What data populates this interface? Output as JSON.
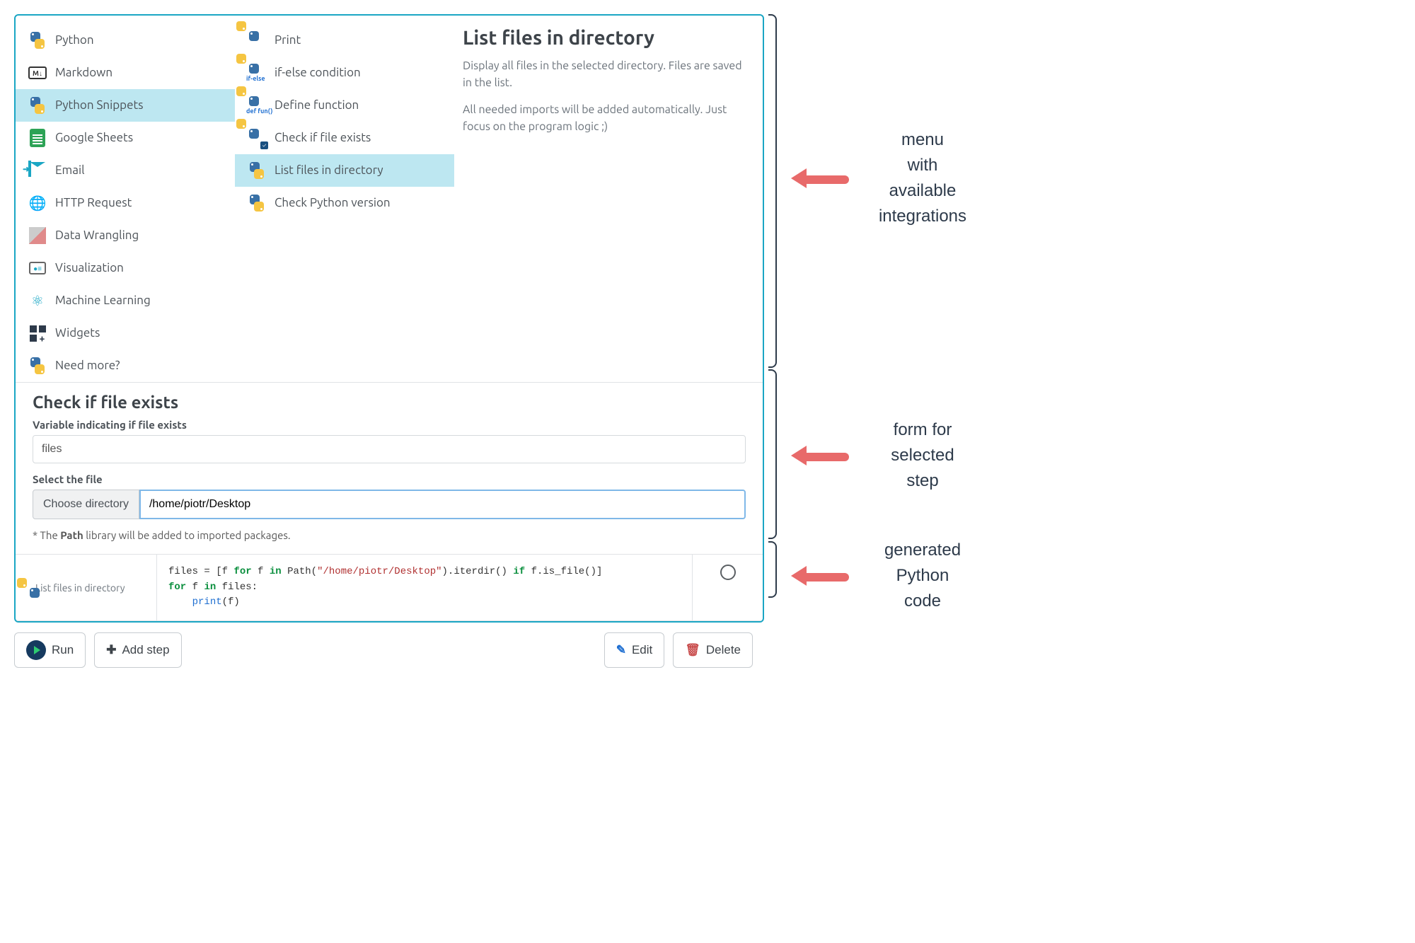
{
  "integrations": [
    {
      "label": "Python",
      "icon": "python-icon"
    },
    {
      "label": "Markdown",
      "icon": "markdown-icon"
    },
    {
      "label": "Python Snippets",
      "icon": "python-icon",
      "selected": true
    },
    {
      "label": "Google Sheets",
      "icon": "sheets-icon"
    },
    {
      "label": "Email",
      "icon": "email-icon"
    },
    {
      "label": "HTTP Request",
      "icon": "http-icon"
    },
    {
      "label": "Data Wrangling",
      "icon": "wrangling-icon"
    },
    {
      "label": "Visualization",
      "icon": "viz-icon"
    },
    {
      "label": "Machine Learning",
      "icon": "ml-icon"
    },
    {
      "label": "Widgets",
      "icon": "widgets-icon"
    },
    {
      "label": "Need more?",
      "icon": "python-icon"
    }
  ],
  "snippets": [
    {
      "label": "Print",
      "sub": ""
    },
    {
      "label": "if-else condition",
      "sub": "if-else"
    },
    {
      "label": "Define function",
      "sub": "def fun()"
    },
    {
      "label": "Check if file exists",
      "sub": "",
      "badge": "check"
    },
    {
      "label": "List files in directory",
      "sub": "",
      "selected": true
    },
    {
      "label": "Check Python version",
      "sub": ""
    }
  ],
  "detail": {
    "title": "List files in directory",
    "desc": "Display all files in the selected directory. Files are saved in the list.",
    "note": "All needed imports will be added automatically. Just focus on the program logic ;)"
  },
  "form": {
    "title": "Check if file exists",
    "var_label": "Variable indicating if file exists",
    "var_value": "files",
    "select_label": "Select the file",
    "choose_button": "Choose directory",
    "path_value": "/home/piotr/Desktop",
    "helper_prefix": "* The ",
    "helper_strong": "Path",
    "helper_suffix": " library will be added to imported packages."
  },
  "cell": {
    "label": "List files in directory",
    "code": {
      "l1a": "files = [f ",
      "l1b": "for",
      "l1c": " f ",
      "l1d": "in",
      "l1e": " Path(",
      "l1f": "\"/home/piotr/Desktop\"",
      "l1g": ").iterdir() ",
      "l1h": "if",
      "l1i": " f.is_file()]",
      "l2a": "for",
      "l2b": " f ",
      "l2c": "in",
      "l2d": " files:",
      "l3a": "    ",
      "l3b": "print",
      "l3c": "(f)"
    }
  },
  "toolbar": {
    "run": "Run",
    "add_step": "Add step",
    "edit": "Edit",
    "delete": "Delete"
  },
  "annotations": {
    "menu": "menu\nwith\navailable\nintegrations",
    "form": "form for\nselected\nstep",
    "code": "generated\nPython\ncode"
  }
}
